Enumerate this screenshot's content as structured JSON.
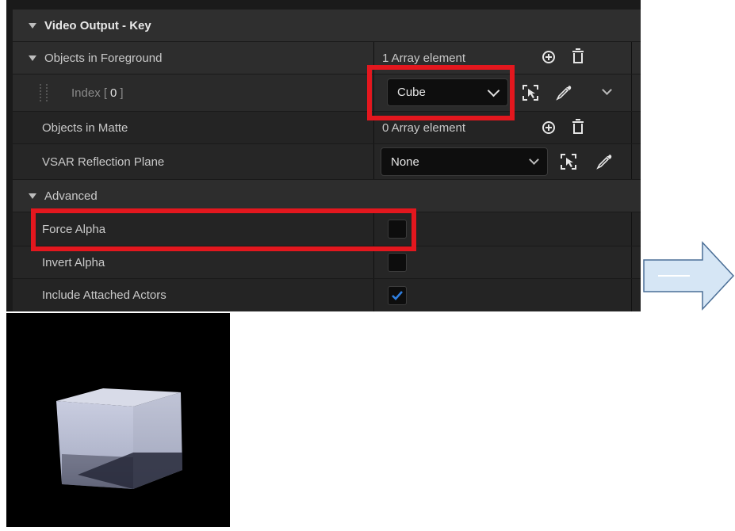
{
  "panel": {
    "section_title": "Video Output - Key",
    "rows": {
      "objects_in_foreground": {
        "label": "Objects in Foreground",
        "value": "1 Array element"
      },
      "index0": {
        "label_prefix": "Index [",
        "index": "0",
        "label_suffix": "]",
        "selected": "Cube"
      },
      "objects_in_matte": {
        "label": "Objects in Matte",
        "value": "0 Array element"
      },
      "vsar_reflection_plane": {
        "label": "VSAR Reflection Plane",
        "selected": "None"
      },
      "advanced": {
        "label": "Advanced"
      },
      "force_alpha": {
        "label": "Force Alpha",
        "checked": false
      },
      "invert_alpha": {
        "label": "Invert Alpha",
        "checked": false
      },
      "include_attached_actors": {
        "label": "Include Attached Actors",
        "checked": true
      }
    }
  },
  "colors": {
    "highlight": "#e3171e",
    "checkmark": "#2f7fe0",
    "arrow_fill": "#d6e6f5",
    "arrow_stroke": "#4a6e96"
  },
  "icons": [
    "expand-triangle-icon",
    "add-element-icon",
    "delete-icon",
    "browse-select-icon",
    "eyedropper-icon",
    "chevron-down-icon",
    "checkmark-icon",
    "right-arrow-icon"
  ],
  "preview": {
    "description_icon": "cube-render"
  }
}
